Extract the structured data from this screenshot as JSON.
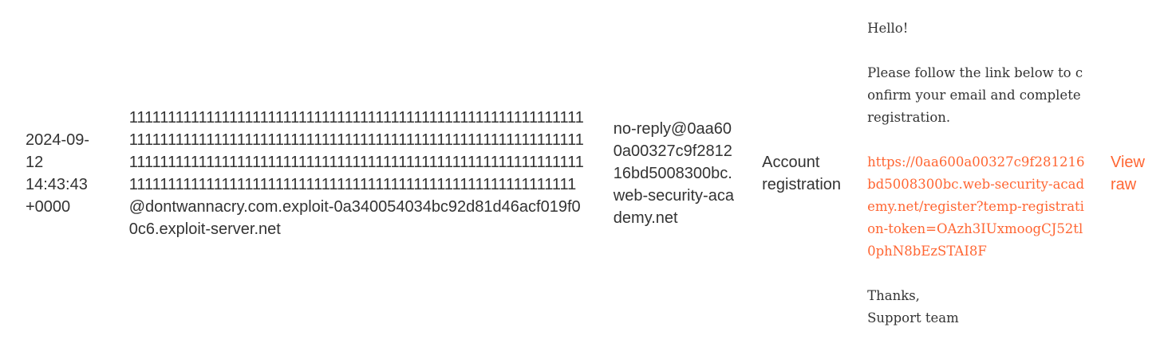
{
  "email": {
    "sent": {
      "date": "2024-09-12",
      "time": "14:43:43",
      "offset": "+0000"
    },
    "to": "1111111111111111111111111111111111111111111111111111111111111111111111111111111111111111111111111111111111111111111111111111111111111111111111111111111111111111111111111111111111111111111111111111111111111111111111111111111111111111111@dontwannacry.com.exploit-0a340054034bc92d81d46acf019f00c6.exploit-server.net",
    "from": "no-reply@0aa600a00327c9f281216bd5008300bc.web-security-academy.net",
    "subject": "Account registration",
    "body": {
      "greeting": "Hello!",
      "instruction": "Please follow the link below to confirm your email and complete registration.",
      "link": "https://0aa600a00327c9f281216bd5008300bc.web-security-academy.net/register?temp-registration-token=OAzh3IUxmoogCJ52tl0phN8bEzSTAI8F",
      "signoff": "Thanks,",
      "signature": "Support team"
    },
    "view_raw_label": "View raw"
  },
  "colors": {
    "text": "#333333",
    "link": "#ff6633",
    "background": "#ffffff"
  }
}
